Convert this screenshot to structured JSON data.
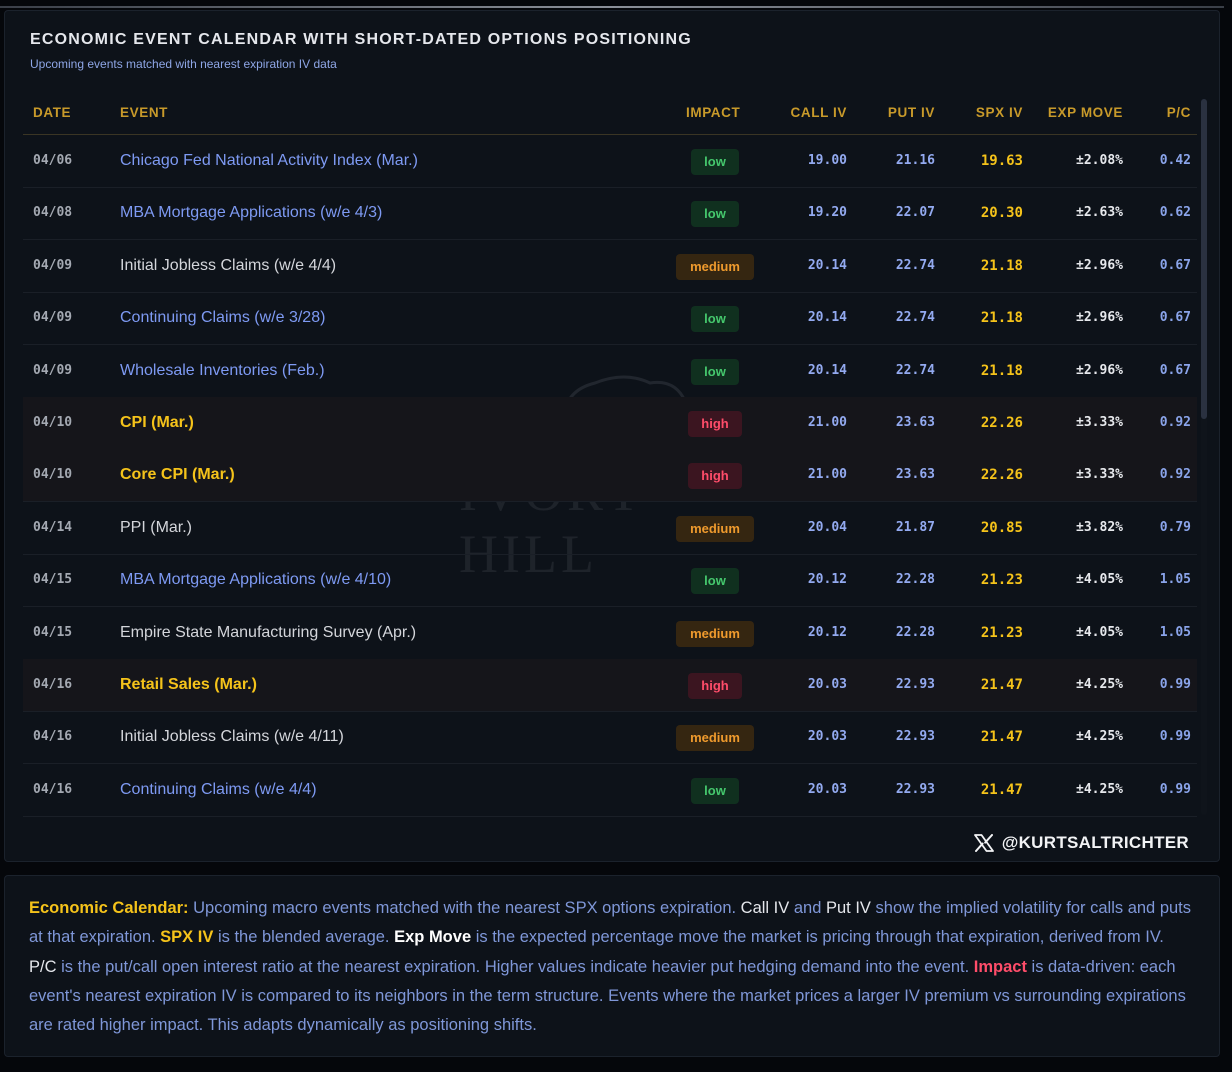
{
  "header": {
    "title": "ECONOMIC EVENT CALENDAR WITH SHORT-DATED OPTIONS POSITIONING",
    "subtitle": "Upcoming events matched with nearest expiration IV data"
  },
  "table": {
    "columns": {
      "date": "DATE",
      "event": "EVENT",
      "impact": "IMPACT",
      "call_iv": "CALL IV",
      "put_iv": "PUT IV",
      "spx_iv": "SPX IV",
      "exp_move": "EXP MOVE",
      "pc": "P/C"
    },
    "rows": [
      {
        "date": "04/06",
        "event": "Chicago Fed National Activity Index (Mar.)",
        "impact": "low",
        "call_iv": "19.00",
        "put_iv": "21.16",
        "spx_iv": "19.63",
        "exp_move": "±2.08%",
        "pc": "0.42"
      },
      {
        "date": "04/08",
        "event": "MBA Mortgage Applications (w/e 4/3)",
        "impact": "low",
        "call_iv": "19.20",
        "put_iv": "22.07",
        "spx_iv": "20.30",
        "exp_move": "±2.63%",
        "pc": "0.62"
      },
      {
        "date": "04/09",
        "event": "Initial Jobless Claims (w/e 4/4)",
        "impact": "medium",
        "call_iv": "20.14",
        "put_iv": "22.74",
        "spx_iv": "21.18",
        "exp_move": "±2.96%",
        "pc": "0.67"
      },
      {
        "date": "04/09",
        "event": "Continuing Claims (w/e 3/28)",
        "impact": "low",
        "call_iv": "20.14",
        "put_iv": "22.74",
        "spx_iv": "21.18",
        "exp_move": "±2.96%",
        "pc": "0.67"
      },
      {
        "date": "04/09",
        "event": "Wholesale Inventories (Feb.)",
        "impact": "low",
        "call_iv": "20.14",
        "put_iv": "22.74",
        "spx_iv": "21.18",
        "exp_move": "±2.96%",
        "pc": "0.67"
      },
      {
        "date": "04/10",
        "event": "CPI (Mar.)",
        "impact": "high",
        "call_iv": "21.00",
        "put_iv": "23.63",
        "spx_iv": "22.26",
        "exp_move": "±3.33%",
        "pc": "0.92"
      },
      {
        "date": "04/10",
        "event": "Core CPI (Mar.)",
        "impact": "high",
        "call_iv": "21.00",
        "put_iv": "23.63",
        "spx_iv": "22.26",
        "exp_move": "±3.33%",
        "pc": "0.92"
      },
      {
        "date": "04/14",
        "event": "PPI (Mar.)",
        "impact": "medium",
        "call_iv": "20.04",
        "put_iv": "21.87",
        "spx_iv": "20.85",
        "exp_move": "±3.82%",
        "pc": "0.79"
      },
      {
        "date": "04/15",
        "event": "MBA Mortgage Applications (w/e 4/10)",
        "impact": "low",
        "call_iv": "20.12",
        "put_iv": "22.28",
        "spx_iv": "21.23",
        "exp_move": "±4.05%",
        "pc": "1.05"
      },
      {
        "date": "04/15",
        "event": "Empire State Manufacturing Survey (Apr.)",
        "impact": "medium",
        "call_iv": "20.12",
        "put_iv": "22.28",
        "spx_iv": "21.23",
        "exp_move": "±4.05%",
        "pc": "1.05"
      },
      {
        "date": "04/16",
        "event": "Retail Sales (Mar.)",
        "impact": "high",
        "call_iv": "20.03",
        "put_iv": "22.93",
        "spx_iv": "21.47",
        "exp_move": "±4.25%",
        "pc": "0.99"
      },
      {
        "date": "04/16",
        "event": "Initial Jobless Claims (w/e 4/11)",
        "impact": "medium",
        "call_iv": "20.03",
        "put_iv": "22.93",
        "spx_iv": "21.47",
        "exp_move": "±4.25%",
        "pc": "0.99"
      },
      {
        "date": "04/16",
        "event": "Continuing Claims (w/e 4/4)",
        "impact": "low",
        "call_iv": "20.03",
        "put_iv": "22.93",
        "spx_iv": "21.47",
        "exp_move": "±4.25%",
        "pc": "0.99"
      }
    ]
  },
  "watermark": {
    "text": "IVORY HILL",
    "icon": "elephant-icon"
  },
  "social": {
    "handle": "@KURTSALTRICHTER",
    "icon": "x-logo-icon"
  },
  "info": {
    "econ_label": "Economic Calendar:",
    "t1": " Upcoming macro events matched with the nearest SPX options expiration. ",
    "call_iv": "Call IV",
    "t2": " and ",
    "put_iv": "Put IV",
    "t3": " show the implied volatility for calls and puts at that expiration. ",
    "spx_iv": "SPX IV",
    "t4": " is the blended average. ",
    "exp_move": "Exp Move",
    "t5": " is the expected percentage move the market is pricing through that expiration, derived from IV. ",
    "pc": "P/C",
    "t6": " is the put/call open interest ratio at the nearest expiration. Higher values indicate heavier put hedging demand into the event. ",
    "impact": "Impact",
    "t7": " is data-driven: each event's nearest expiration IV is compared to its neighbors in the term structure. Events where the market prices a larger IV premium vs surrounding expirations are rated higher impact. This adapts dynamically as positioning shifts."
  },
  "colors": {
    "accent_gold": "#f5c31a",
    "header_gold": "#c89a2a",
    "low_event": "#7e9af3",
    "impact_low": "#45c86d",
    "impact_medium": "#ef9a2d",
    "impact_high": "#ff4d6a"
  }
}
